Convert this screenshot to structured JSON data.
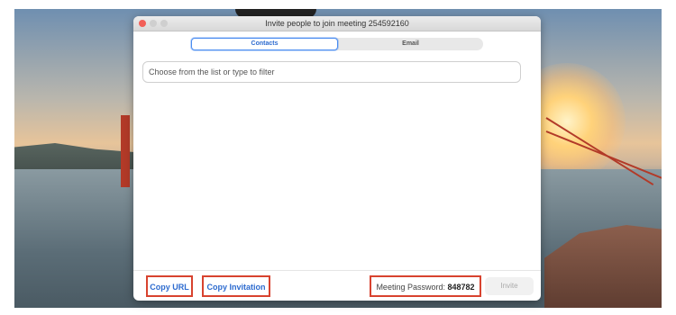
{
  "window": {
    "title": "Invite people to join meeting 254592160"
  },
  "tabs": [
    {
      "label": "Contacts",
      "active": true
    },
    {
      "label": "Email",
      "active": false
    }
  ],
  "filter": {
    "placeholder": "Choose from the list or type to filter",
    "value": ""
  },
  "footer": {
    "copy_url_label": "Copy URL",
    "copy_invitation_label": "Copy Invitation",
    "password_label": "Meeting Password:",
    "password_value": "848782",
    "invite_label": "Invite"
  },
  "colors": {
    "accent": "#2d6bcf",
    "highlight": "#d8432f",
    "close_button": "#f25f58"
  }
}
